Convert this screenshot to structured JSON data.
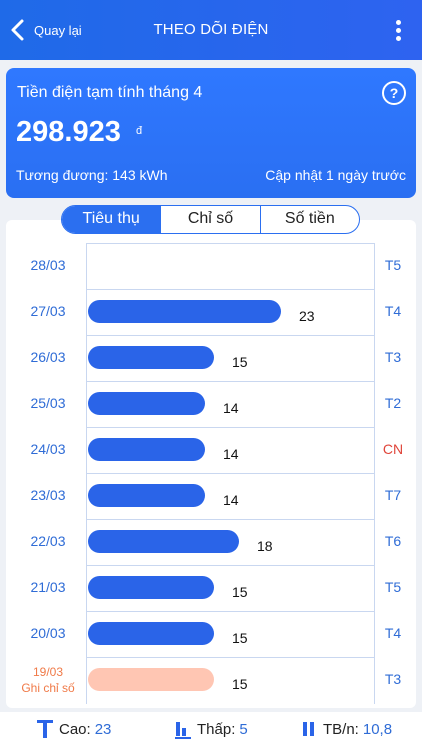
{
  "header": {
    "back_label": "Quay lại",
    "title": "THEO DÕI ĐIỆN"
  },
  "summary": {
    "title": "Tiền điện tạm tính tháng 4",
    "amount": "298.923",
    "unit": "đ",
    "equivalent": "Tương đương: 143 kWh",
    "updated": "Cập nhật 1 ngày trước"
  },
  "tabs": [
    {
      "label": "Tiêu thụ",
      "active": true
    },
    {
      "label": "Chỉ số",
      "active": false
    },
    {
      "label": "Số tiền",
      "active": false
    }
  ],
  "chart_data": {
    "type": "bar",
    "orientation": "horizontal",
    "categories": [
      "28/03",
      "27/03",
      "26/03",
      "25/03",
      "24/03",
      "23/03",
      "22/03",
      "21/03",
      "20/03",
      "19/03"
    ],
    "day_labels": [
      "T5",
      "T4",
      "T3",
      "T2",
      "CN",
      "T7",
      "T6",
      "T5",
      "T4",
      "T3"
    ],
    "values": [
      null,
      23,
      15,
      14,
      14,
      14,
      18,
      15,
      15,
      15
    ],
    "value_labels": [
      "",
      "23",
      "15",
      "14",
      "14",
      "14",
      "18",
      "15",
      "15",
      "15"
    ],
    "special_note": "Ghi chỉ số",
    "special_index": 9,
    "xlim": [
      0,
      26
    ],
    "colors": {
      "bar": "#2a64e8",
      "special_bar": "#ffc6b3",
      "sunday": "#e0453a",
      "label": "#2f6cd6"
    }
  },
  "footer": {
    "high_label": "Cao:",
    "high_value": "23",
    "low_label": "Thấp:",
    "low_value": "5",
    "avg_label": "TB/n:",
    "avg_value": "10,8"
  }
}
